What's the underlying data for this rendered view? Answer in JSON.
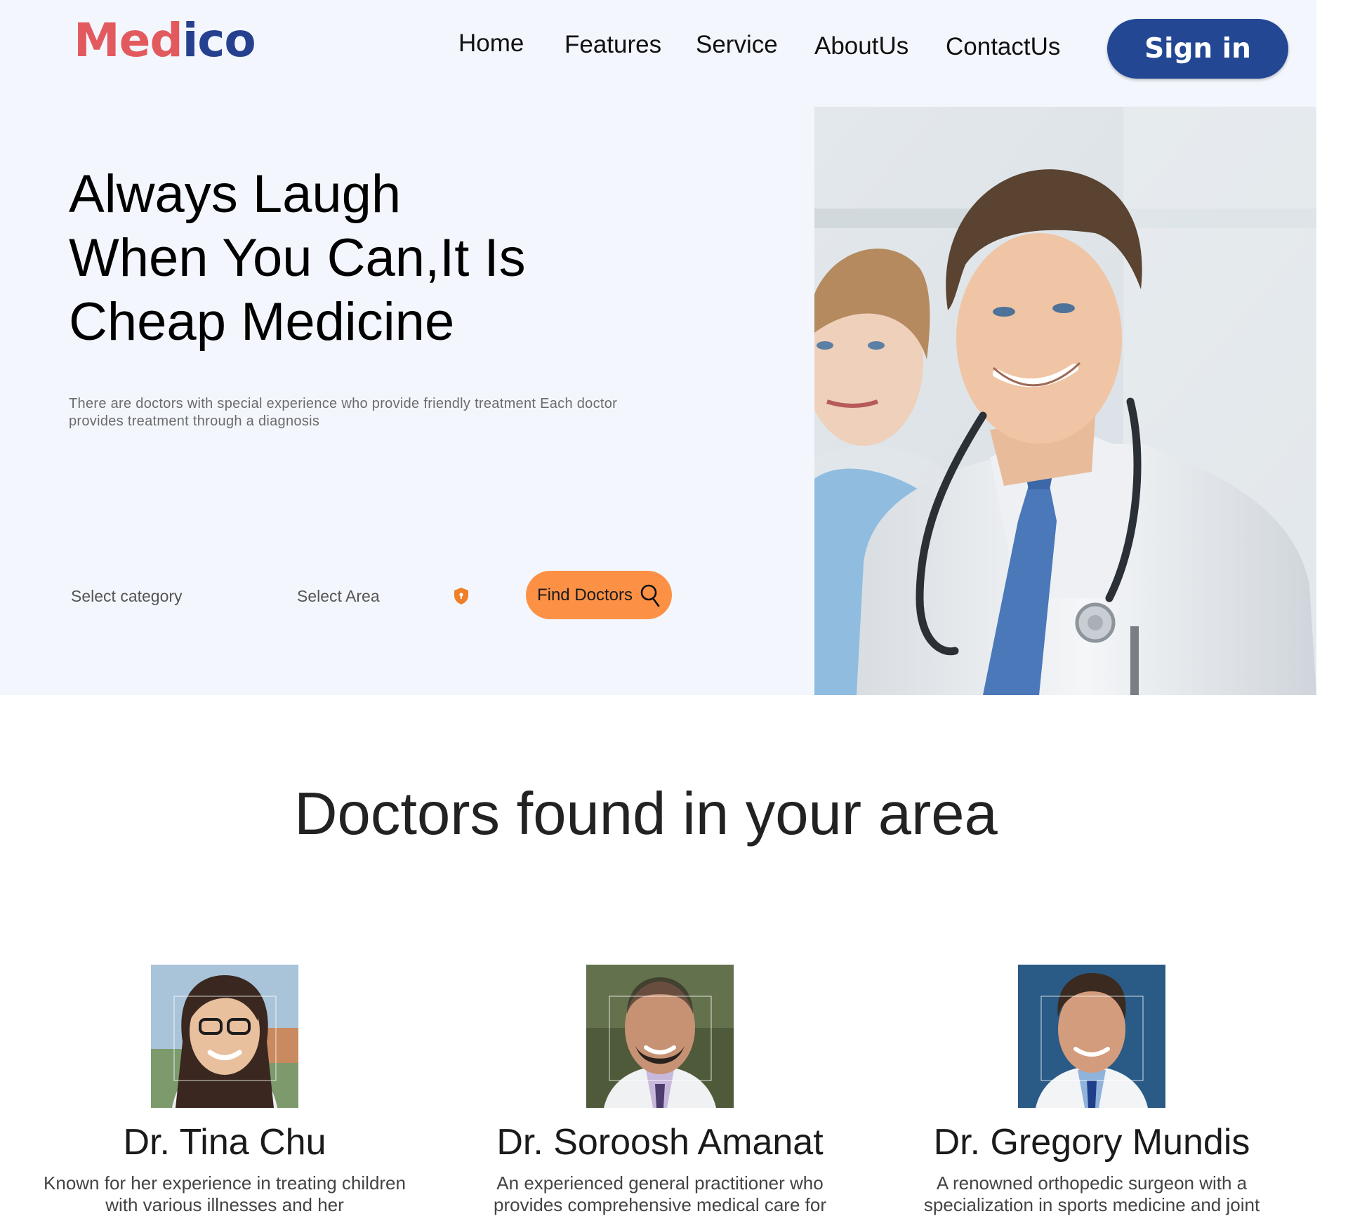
{
  "brand": {
    "logo_part1": "Med",
    "logo_part2": "ico",
    "color1": "#e25a5e",
    "color2": "#25408f"
  },
  "nav": {
    "items": [
      {
        "label": "Home"
      },
      {
        "label": "Features"
      },
      {
        "label": "Service"
      },
      {
        "label": "AboutUs"
      },
      {
        "label": "ContactUs"
      }
    ],
    "signin_label": "Sign in",
    "signin_color": "#234793"
  },
  "hero": {
    "title_lines": [
      "Always Laugh",
      "When You Can,It Is",
      "Cheap Medicine"
    ],
    "description": "There are doctors with special experience who provide friendly treatment Each doctor provides treatment through a diagnosis",
    "category_placeholder": "Select category",
    "area_placeholder": "Select Area",
    "find_button_label": "Find Doctors",
    "accent_color": "#fc9146"
  },
  "doctors_section": {
    "title": "Doctors found in your area",
    "doctors": [
      {
        "name": "Dr. Tina Chu",
        "description": "Known for her experience in treating children with various illnesses and her"
      },
      {
        "name": "Dr. Soroosh Amanat",
        "description": "An experienced general practitioner who provides comprehensive medical care for"
      },
      {
        "name": "Dr. Gregory Mundis",
        "description": "A renowned orthopedic surgeon with a specialization in sports medicine and joint"
      }
    ]
  }
}
